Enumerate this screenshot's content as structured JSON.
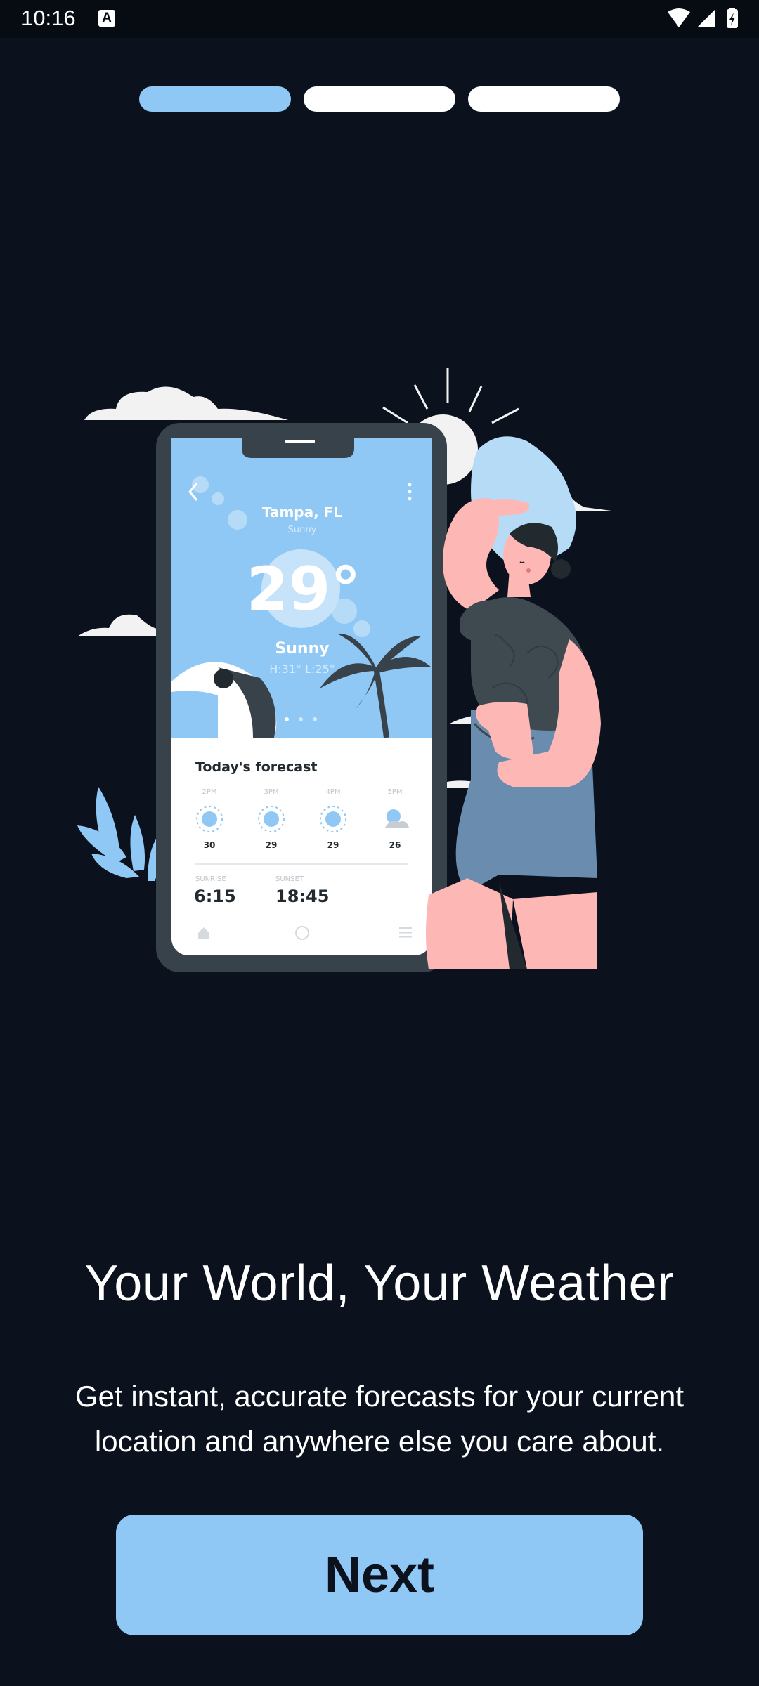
{
  "status_bar": {
    "time": "10:16",
    "notification_icon": "a-letter-icon",
    "wifi_icon": "wifi-icon",
    "signal_icon": "signal-icon",
    "battery_icon": "battery-charging-icon"
  },
  "onboarding": {
    "step_count": 3,
    "current_step": 1,
    "active_color": "#90c8f5",
    "inactive_color": "#ffffff"
  },
  "illustration": {
    "phone": {
      "location": "Tampa, FL",
      "condition_small": "Sunny",
      "temperature": "29°",
      "condition": "Sunny",
      "hi_lo": "H:31°   L:25°",
      "forecast_title": "Today's forecast",
      "hours": [
        "2PM",
        "3PM",
        "4PM",
        "5PM"
      ],
      "forecast_temps": [
        "30",
        "29",
        "29",
        "26"
      ],
      "sunrise_label": "SUNRISE",
      "sunrise": "6:15",
      "sunset_label": "SUNSET",
      "sunset": "18:45"
    }
  },
  "content": {
    "headline": "Your World, Your Weather",
    "description": "Get instant, accurate forecasts for your current location and anywhere else you care about.",
    "next_label": "Next"
  },
  "colors": {
    "background": "#0b111d",
    "accent": "#90c8f5",
    "skin": "#fdb7b5",
    "dark_shirt": "#3e4a50",
    "shorts": "#6a8cae"
  }
}
